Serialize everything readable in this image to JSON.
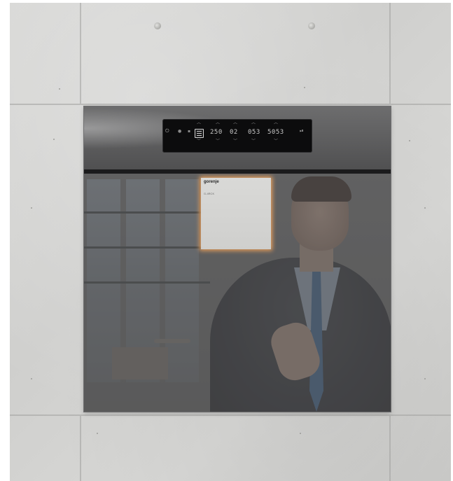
{
  "brand": {
    "logo_text": "gorenje",
    "model_text": "G-4RCK"
  },
  "display": {
    "temperature": "250",
    "program_num": "02",
    "time_1": "053",
    "time_2": "5053"
  },
  "icons": {
    "power": "power-icon",
    "lock": "lock-icon",
    "child_lock": "child-lock-icon",
    "program": "program-icon",
    "up": "chevron-up-icon",
    "down": "chevron-down-icon",
    "light": "light-icon",
    "start": "start-stop-icon"
  },
  "colors": {
    "wall": "#d4d4d2",
    "glass": "#4a4a4b",
    "display_bg": "#0c0c0d",
    "display_text": "#c9c9c9",
    "label_glow": "#ffaa5a"
  }
}
